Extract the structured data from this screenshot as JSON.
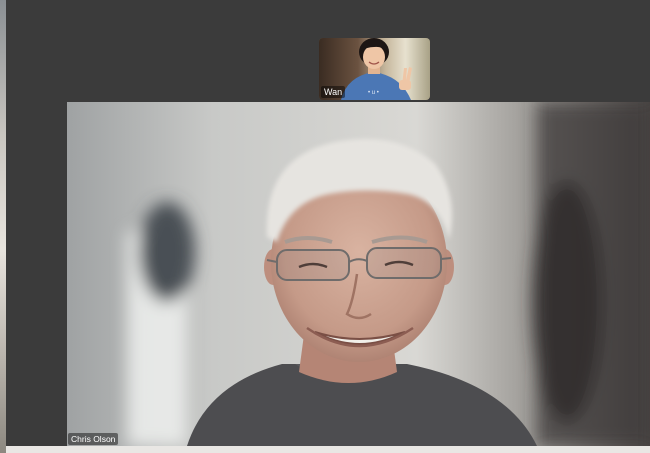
{
  "participants": {
    "thumbnail": {
      "name": "Wan"
    },
    "speaker": {
      "name": "Chris Olson"
    }
  },
  "colors": {
    "window_background": "#3b3b3b",
    "label_background": "rgba(0,0,0,0.45)",
    "label_text": "#ffffff"
  }
}
